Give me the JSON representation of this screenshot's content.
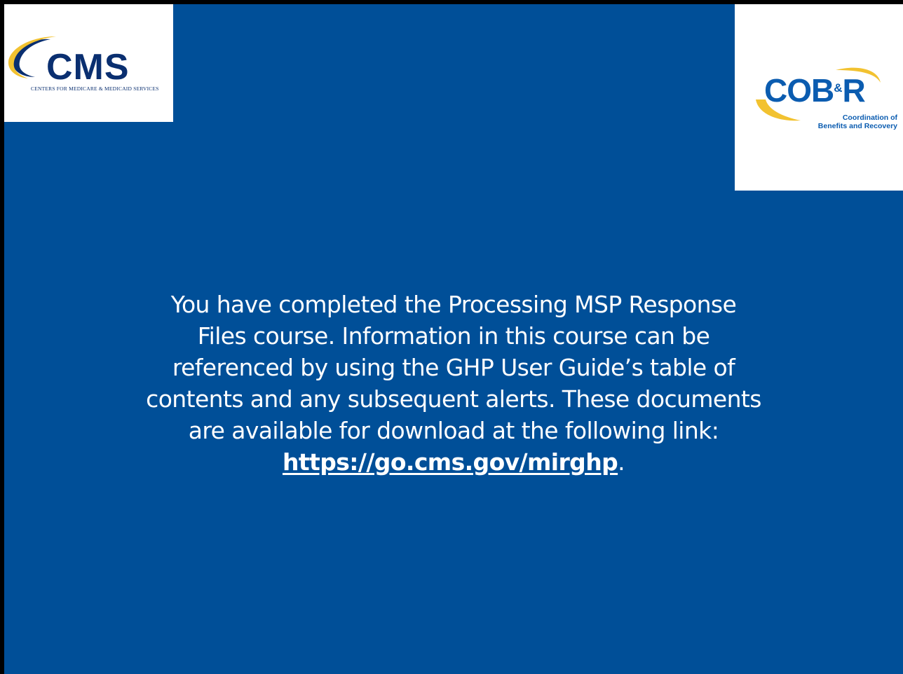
{
  "slide": {
    "background_color": "#004f98",
    "text_color": "#ffffff"
  },
  "logos": {
    "cms": {
      "wordmark": "CMS",
      "subtitle": "CENTERS FOR MEDICARE & MEDICAID SERVICES",
      "color": "#0a2f70",
      "swoosh_color": "#f2c230"
    },
    "cobr": {
      "wordmark_main": "COB",
      "wordmark_amp": "&",
      "wordmark_end": "R",
      "subtitle_line1": "Coordination of",
      "subtitle_line2": "Benefits and Recovery",
      "color": "#0b5cb0",
      "swoosh_color": "#f2c230"
    }
  },
  "message": {
    "line1": "You have completed the Processing MSP Response",
    "line2": "Files course. Information in this course can be",
    "line3": "referenced by using the GHP User Guide’s table of",
    "line4": "contents and any subsequent alerts. These documents",
    "line5": "are available for download at the following link:",
    "link_text": "https://go.cms.gov/mirghp",
    "link_suffix": "."
  }
}
